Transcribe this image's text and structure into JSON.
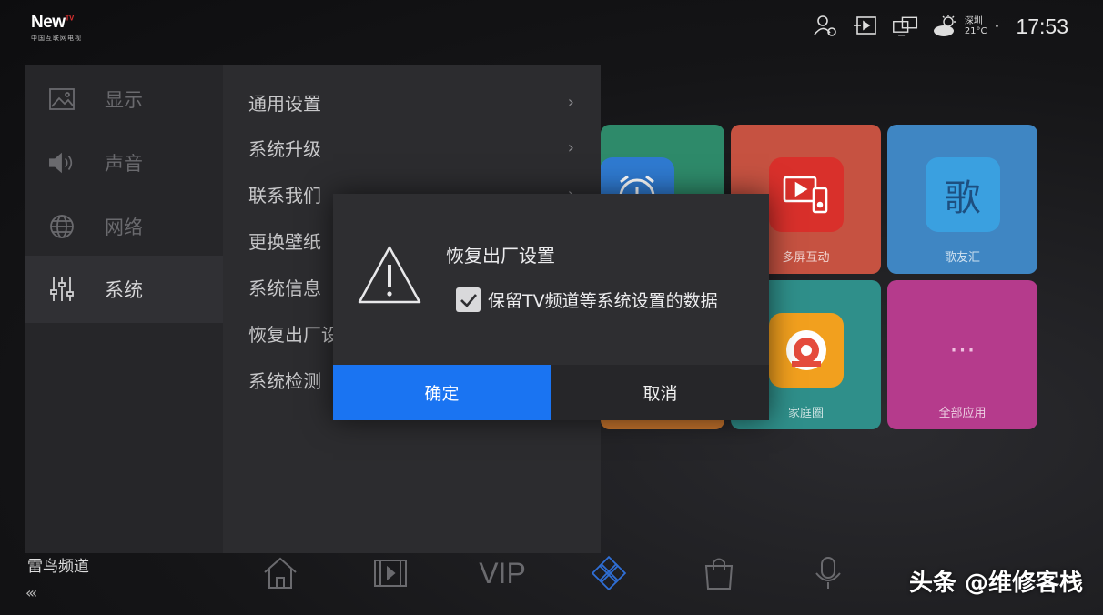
{
  "logo": {
    "brand": "New",
    "brand_sup": "TV",
    "subtitle": "中国互联网电视"
  },
  "status_bar": {
    "icons": [
      "user-settings-icon",
      "input-source-icon",
      "screen-mirror-icon"
    ],
    "weather": {
      "city": "深圳",
      "temp": "21°C",
      "icon": "partly-cloudy-icon"
    },
    "time": "17:53"
  },
  "settings": {
    "categories": [
      {
        "label": "显示",
        "icon": "image-icon",
        "active": false
      },
      {
        "label": "声音",
        "icon": "speaker-icon",
        "active": false
      },
      {
        "label": "网络",
        "icon": "globe-icon",
        "active": false
      },
      {
        "label": "系统",
        "icon": "sliders-icon",
        "active": true
      }
    ],
    "menu": [
      {
        "label": "通用设置",
        "arrow": "›"
      },
      {
        "label": "系统升级",
        "arrow": "›"
      },
      {
        "label": "联系我们",
        "arrow": "›"
      },
      {
        "label": "更换壁纸",
        "arrow": ""
      },
      {
        "label": "系统信息",
        "arrow": ""
      },
      {
        "label": "恢复出厂设置",
        "arrow": ""
      },
      {
        "label": "系统检测",
        "arrow": ""
      }
    ]
  },
  "dialog": {
    "title": "恢复出厂设置",
    "checkbox_label": "保留TV频道等系统设置的数据",
    "checkbox_checked": true,
    "confirm_label": "确定",
    "cancel_label": "取消"
  },
  "tiles": [
    {
      "label": "多屏互动",
      "color": "#e0563f"
    },
    {
      "label": "歌友汇",
      "icon_text": "歌",
      "color": "#2f8fd6"
    },
    {
      "label": "家庭圈",
      "color": "#3aa39c"
    },
    {
      "label": "全部应用",
      "icon_text": "···",
      "color": "#c03c8f"
    }
  ],
  "bottom": {
    "channel": "雷鸟频道",
    "chevrons": "‹‹‹",
    "vip": "VIP"
  },
  "watermark": "头条 @维修客栈",
  "colors": {
    "accent": "#1a74f2"
  }
}
